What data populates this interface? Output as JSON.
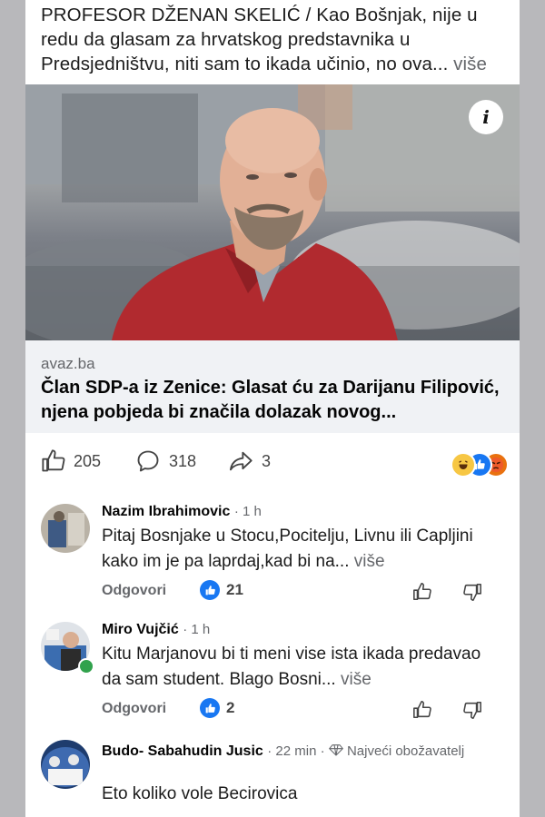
{
  "post": {
    "text": "PROFESOR DŽENAN SKELIĆ / Kao Bošnjak, nije u redu da glasam za hrvatskog predstavnika u Predsjedništvu, niti sam to ikada učinio, no ova...",
    "more": "više",
    "link_domain": "avaz.ba",
    "link_title": "Član SDP-a iz Zenice: Glasat ću za Darijanu Filipović, njena pobjeda bi značila dolazak novog..."
  },
  "stats": {
    "likes": "205",
    "comments": "318",
    "shares": "3"
  },
  "comments": [
    {
      "name": "Nazim Ibrahimovic",
      "time": "1 h",
      "text": "Pitaj Bosnjake u Stocu,Pocitelju, Livnu ili Capljini kako im je pa laprdaj,kad bi na...",
      "more": "više",
      "reply": "Odgovori",
      "likes": "21"
    },
    {
      "name": "Miro Vujčić",
      "time": "1 h",
      "text": "Kitu Marjanovu bi ti meni vise ista ikada predavao da sam student. Blago Bosni...",
      "more": "više",
      "reply": "Odgovori",
      "likes": "2"
    },
    {
      "name": "Budo- Sabahudin Jusic",
      "time": "22 min",
      "badge": "Najveći obožavatelj",
      "text": "Eto koliko  vole Becirovica"
    }
  ]
}
